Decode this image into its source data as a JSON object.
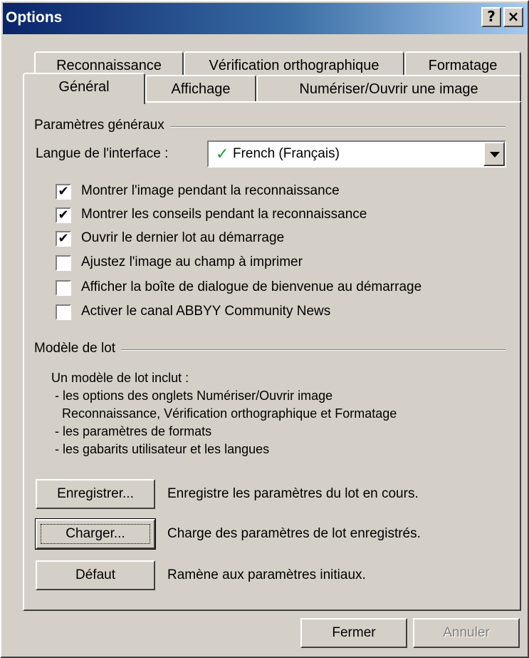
{
  "window": {
    "title": "Options",
    "help_button": "?",
    "close_button": "×"
  },
  "tabs": {
    "row_back": [
      "Reconnaissance",
      "Vérification orthographique",
      "Formatage"
    ],
    "row_front": [
      "Général",
      "Affichage",
      "Numériser/Ouvrir une image"
    ],
    "active": "Général"
  },
  "general_settings": {
    "group_title": "Paramètres généraux",
    "language_label": "Langue de l'interface :",
    "language_value": "French (Français)",
    "language_icon": "green-check-icon",
    "checkboxes": [
      {
        "label": "Montrer l'image pendant la reconnaissance",
        "checked": true
      },
      {
        "label": "Montrer les conseils pendant la reconnaissance",
        "checked": true
      },
      {
        "label": "Ouvrir le dernier lot au démarrage",
        "checked": true
      },
      {
        "label": "Ajustez l'image au champ à imprimer",
        "checked": false
      },
      {
        "label": "Afficher la boîte de dialogue de bienvenue au démarrage",
        "checked": false
      },
      {
        "label": "Activer le canal ABBYY Community News",
        "checked": false
      }
    ]
  },
  "batch_model": {
    "group_title": "Modèle de lot",
    "description_lines": [
      "Un modèle de lot inclut :",
      " - les options des onglets Numériser/Ouvrir image",
      "   Reconnaissance, Vérification orthographique et Formatage",
      " - les paramètres de formats",
      " - les gabarits utilisateur et les langues"
    ],
    "actions": [
      {
        "label": "Enregistrer...",
        "description": "Enregistre les paramètres du lot en cours."
      },
      {
        "label": "Charger...",
        "description": "Charge des paramètres de lot enregistrés."
      },
      {
        "label": "Défaut",
        "description": "Ramène aux paramètres initiaux."
      }
    ]
  },
  "footer": {
    "close_label": "Fermer",
    "cancel_label": "Annuler"
  }
}
